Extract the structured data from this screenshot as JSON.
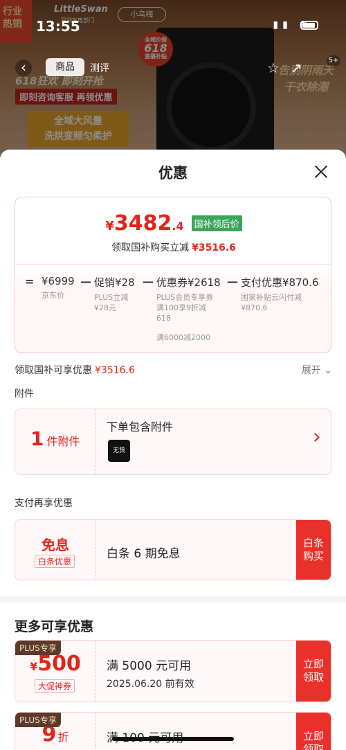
{
  "background": {
    "status_time": "13:55",
    "banner_left": "行业 热销",
    "brand": "LittleSwan",
    "brand_sub": "受到家电部门",
    "brand2": "小乌梅",
    "seal_top": "全域价保",
    "seal_mid": "618",
    "seal_bottom": "直播补贴",
    "tab_active": "商品",
    "tab_other": "测评",
    "promo_line1": "618狂欢 即刻开抢",
    "promo_line2": "即刻咨询客服 再领优惠",
    "promo_box1": "全域大风量",
    "promo_box2": "洗烘变频匀柔护",
    "count": "5+",
    "slogan": "告别阴雨天 干衣除潮"
  },
  "sheet": {
    "title": "优惠",
    "price": {
      "currency": "¥",
      "integer": "3482",
      "decimal": ".4",
      "badge": "国补领后价",
      "sub_label": "领取国补购买立减",
      "sub_value": "¥3516.6"
    },
    "formula": {
      "eq": "=",
      "minus": "—",
      "items": [
        {
          "value": "¥6999",
          "note": "京东价"
        },
        {
          "value": "促销¥28",
          "note": "PLUS立减\n¥28元"
        },
        {
          "value": "优惠券¥2618",
          "note": "PLUS会员专享券\n满100享9折减\n618",
          "note2": "满6000减2000"
        },
        {
          "value": "支付优惠¥870.6",
          "note": "国家补贴云闪付减\n¥870.6"
        }
      ]
    },
    "gov_row": {
      "label": "领取国补可享优惠",
      "value": "¥3516.6",
      "expand": "展开"
    },
    "accessory_section": "附件",
    "accessory": {
      "count": "1",
      "unit": "件附件",
      "title": "下单包含附件",
      "thumb_text": "无货"
    },
    "pay_section": "支付再享优惠",
    "pay": {
      "big": "免息",
      "tag": "白条优惠",
      "text": "白条 6 期免息",
      "button": "白条\n购买"
    },
    "more_title": "更多可享优惠",
    "coupons": [
      {
        "plus": "PLUS专享",
        "currency": "¥",
        "amount": "500",
        "unit": "",
        "tag": "大促神券",
        "title": "满 5000 元可用",
        "date": "2025.06.20 前有效",
        "button": "立即\n领取"
      },
      {
        "plus": "PLUS专享",
        "currency": "",
        "amount": "9",
        "unit": "折",
        "tag": "",
        "title": "满 100 元可用",
        "date": "",
        "button": "立即\n领取"
      }
    ]
  },
  "colors": {
    "accent": "#e1251b",
    "badge_green": "#3ca45c",
    "button_red": "#e8312a"
  }
}
